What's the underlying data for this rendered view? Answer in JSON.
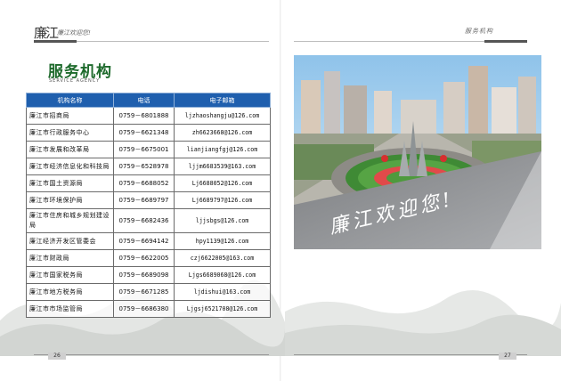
{
  "header": {
    "brand": "廉江",
    "tagline": "廉江欢迎您!",
    "section": "服务机构"
  },
  "title": "服务机构",
  "subtitle": "SERVICE AGENCY",
  "table": {
    "columns": [
      "机构名称",
      "电话",
      "电子邮箱"
    ],
    "rows": [
      {
        "org": "廉江市招商局",
        "phone": "0759－6801888",
        "email": "ljzhaoshangju@126.com"
      },
      {
        "org": "廉江市行政服务中心",
        "phone": "0759－6621348",
        "email": "zh6623668@126.com"
      },
      {
        "org": "廉江市发展和改革局",
        "phone": "0759－6675001",
        "email": "lianjiangfgj@126.com"
      },
      {
        "org": "廉江市经济信息化和科技局",
        "phone": "0759－6528978",
        "email": "ljjm6683539@163.com"
      },
      {
        "org": "廉江市国土资源局",
        "phone": "0759－6688052",
        "email": "Lj6688052@126.com"
      },
      {
        "org": "廉江市环境保护局",
        "phone": "0759－6689797",
        "email": "Lj6689797@126.com"
      },
      {
        "org": "廉江市住房和城乡规划建设局",
        "phone": "0759－6682436",
        "email": "ljjsbgs@126.com"
      },
      {
        "org": "廉江经济开发区管委会",
        "phone": "0759－6694142",
        "email": "hpy1139@126.com"
      },
      {
        "org": "廉江市财政局",
        "phone": "0759－6622005",
        "email": "czj6622005@163.com"
      },
      {
        "org": "廉江市国家税务局",
        "phone": "0759－6689098",
        "email": "Ljgs6689068@126.com"
      },
      {
        "org": "廉江市地方税务局",
        "phone": "0759－6671285",
        "email": "ljdishui@163.com"
      },
      {
        "org": "廉江市市场监管局",
        "phone": "0759－6686380",
        "email": "Ljgsj6521708@126.com"
      }
    ]
  },
  "photo_caption": "廉江欢迎您!",
  "footer": {
    "page_left": "26",
    "page_right": "27"
  },
  "colors": {
    "header_blue": "#1f5fae",
    "title_green": "#1e6a2c"
  }
}
